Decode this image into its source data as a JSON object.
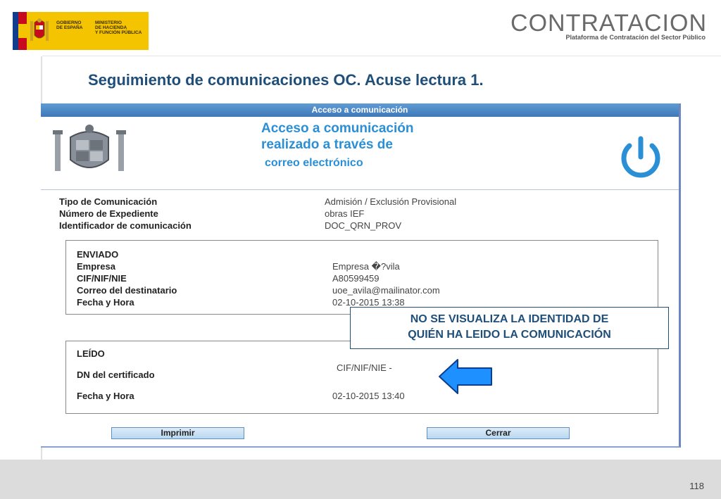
{
  "header": {
    "gov_line1": "GOBIERNO",
    "gov_line2": "DE ESPAÑA",
    "ministry_line1": "MINISTERIO",
    "ministry_line2": "DE HACIENDA",
    "ministry_line3": "Y FUNCIÓN PÚBLICA",
    "contratacion_title": "CONTRATACION",
    "contratacion_subtitle": "Plataforma de Contratación del Sector Público"
  },
  "slide_title": "Seguimiento de comunicaciones OC. Acuse lectura 1.",
  "window": {
    "titlebar": "Acceso a comunicación",
    "heading_line1": "Acceso a comunicación",
    "heading_line2": "realizado a través de",
    "heading_line3": "correo electrónico"
  },
  "info": [
    {
      "label": "Tipo de Comunicación",
      "value": "Admisión / Exclusión Provisional"
    },
    {
      "label": "Número de Expediente",
      "value": "obras IEF"
    },
    {
      "label": "Identificador de comunicación",
      "value": "DOC_QRN_PROV"
    }
  ],
  "enviado": {
    "title": "ENVIADO",
    "rows": [
      {
        "label": "Empresa",
        "value": "Empresa �?vila"
      },
      {
        "label": "CIF/NIF/NIE",
        "value": "A80599459"
      },
      {
        "label": "Correo del destinatario",
        "value": "uoe_avila@mailinator.com"
      },
      {
        "label": "Fecha y Hora",
        "value": "02-10-2015 13:38"
      }
    ]
  },
  "leido": {
    "title": "LEÍDO",
    "rows": [
      {
        "label": "DN del certificado",
        "value": "CIF/NIF/NIE -"
      },
      {
        "label": "Fecha y Hora",
        "value": "02-10-2015 13:40"
      }
    ]
  },
  "buttons": {
    "print": "Imprimir",
    "close": "Cerrar"
  },
  "notice_line1": "NO SE VISUALIZA LA IDENTIDAD DE",
  "notice_line2": "QUIÉN HA LEIDO LA COMUNICACIÓN",
  "page_number": "118",
  "colors": {
    "title_blue": "#1f4e79",
    "access_blue": "#2b8fd6",
    "arrow_blue": "#1e90ff"
  }
}
